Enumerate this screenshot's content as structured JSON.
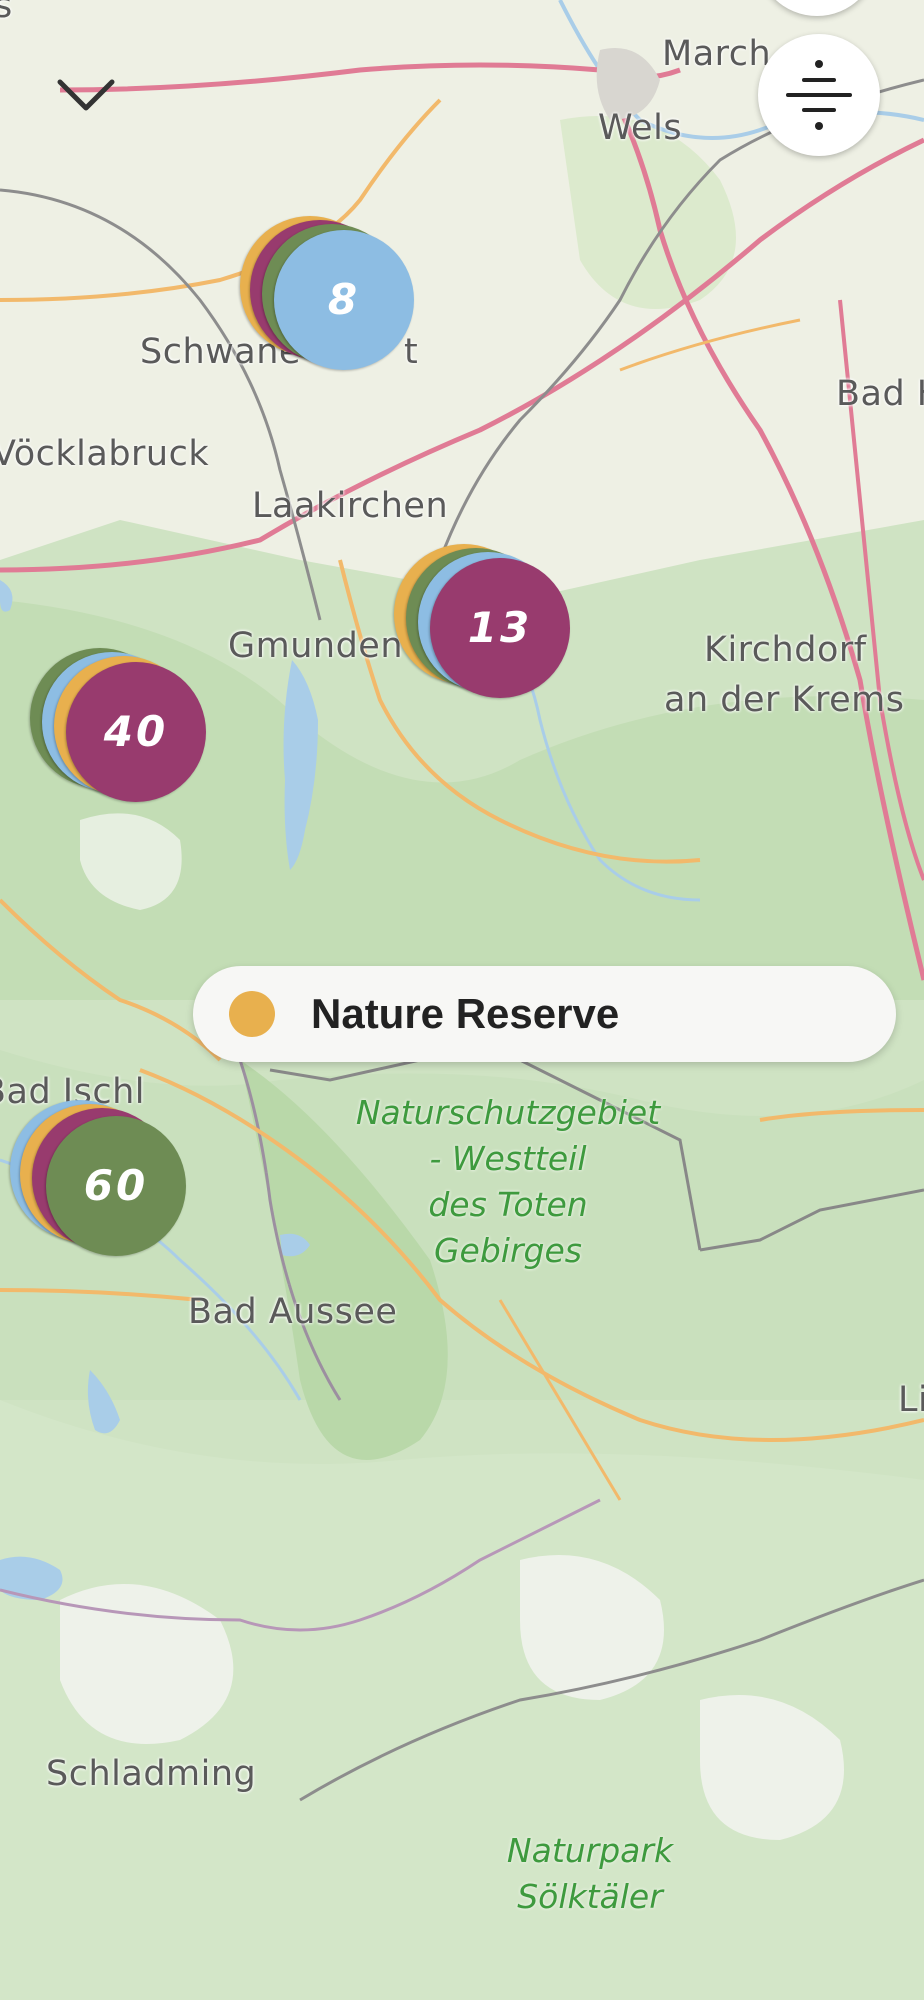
{
  "map": {
    "places": [
      {
        "id": "marchtrenk",
        "label": "March"
      },
      {
        "id": "wels",
        "label": "Wels"
      },
      {
        "id": "schwanenstadt",
        "label": "Schwane"
      },
      {
        "id": "schwanenstadt2",
        "label": "t"
      },
      {
        "id": "bad-hall",
        "label": "Bad H"
      },
      {
        "id": "voecklabruck",
        "label": "Vöcklabruck"
      },
      {
        "id": "laakirchen",
        "label": "Laakirchen"
      },
      {
        "id": "gmunden",
        "label": "Gmunden"
      },
      {
        "id": "kirchdorf",
        "label": "Kirchdorf"
      },
      {
        "id": "krems",
        "label": "an der Krems"
      },
      {
        "id": "bad-ischl",
        "label": "Bad Ischl"
      },
      {
        "id": "bad-aussee",
        "label": "Bad Aussee"
      },
      {
        "id": "schladming",
        "label": "Schladming"
      },
      {
        "id": "li",
        "label": "Li"
      },
      {
        "id": "s-top",
        "label": "s"
      }
    ],
    "parks": [
      {
        "id": "totes-gebirge",
        "lines": [
          "Naturschutzgebiet",
          "- Westteil",
          "des Toten",
          "Gebirges"
        ]
      },
      {
        "id": "soelktaeler",
        "lines": [
          "Naturpark",
          "Sölktäler"
        ]
      }
    ]
  },
  "clusters": [
    {
      "id": "cluster-8",
      "count": "8",
      "front_color": "#8dbde3"
    },
    {
      "id": "cluster-13",
      "count": "13",
      "front_color": "#983b6e"
    },
    {
      "id": "cluster-40",
      "count": "40",
      "front_color": "#983b6e"
    },
    {
      "id": "cluster-60",
      "count": "60",
      "front_color": "#6e8c54"
    }
  ],
  "colors": {
    "yellow": "#e8b04e",
    "purple": "#983b6e",
    "green": "#6e8c54",
    "blue": "#8dbde3"
  },
  "legend": {
    "label": "Nature Reserve",
    "dot_color": "#e8b04e"
  },
  "controls": {
    "collapse_icon": "chevron-down-icon",
    "filter_icon": "filter-lines-icon"
  }
}
